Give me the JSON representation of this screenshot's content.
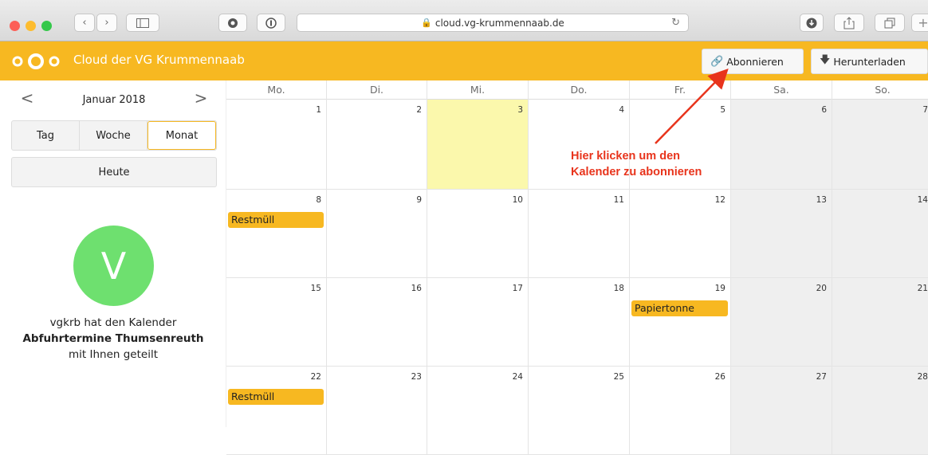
{
  "browser": {
    "url": "cloud.vg-krummennaab.de",
    "traffic_lights": [
      "#fc5f57",
      "#fdbc2e",
      "#34c84a"
    ],
    "new_tab": "+"
  },
  "header": {
    "title": "Cloud der VG Krummennaab",
    "subscribe_label": "Abonnieren",
    "download_label": "Herunterladen",
    "accent": "#f7b821"
  },
  "sidebar": {
    "month": "Januar 2018",
    "prev": "<",
    "next": ">",
    "views": [
      "Tag",
      "Woche",
      "Monat"
    ],
    "active_view": "Monat",
    "today": "Heute",
    "avatar_letter": "V",
    "share_line1": "vgkrb hat den Kalender",
    "share_calendar": "Abfuhrtermine Thumsenreuth",
    "share_line3": "mit Ihnen geteilt"
  },
  "calendar": {
    "weekdays": [
      "Mo.",
      "Di.",
      "Mi.",
      "Do.",
      "Fr.",
      "Sa.",
      "So."
    ],
    "weeks": [
      [
        "1",
        "2",
        "3",
        "4",
        "5",
        "6",
        "7"
      ],
      [
        "8",
        "9",
        "10",
        "11",
        "12",
        "13",
        "14"
      ],
      [
        "15",
        "16",
        "17",
        "18",
        "19",
        "20",
        "21"
      ],
      [
        "22",
        "23",
        "24",
        "25",
        "26",
        "27",
        "28"
      ]
    ],
    "today": "3",
    "events": [
      {
        "day": "8",
        "title": "Restmüll"
      },
      {
        "day": "19",
        "title": "Papiertonne"
      },
      {
        "day": "22",
        "title": "Restmüll"
      }
    ]
  },
  "annotation": {
    "line1": "Hier klicken um den",
    "line2": "Kalender zu abonnieren",
    "color": "#e8341c"
  }
}
